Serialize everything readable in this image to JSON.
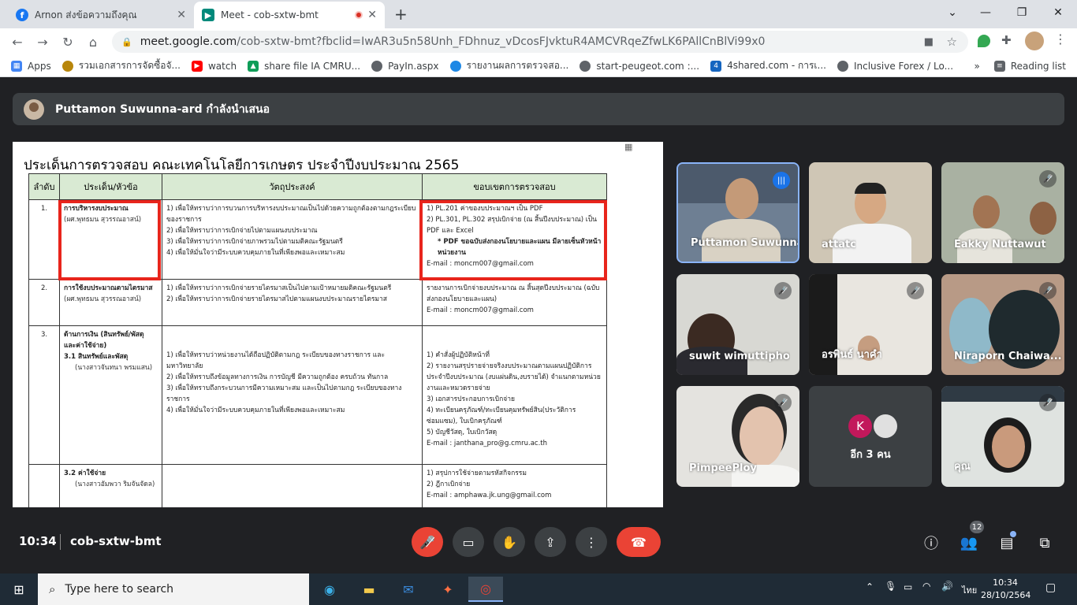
{
  "browser": {
    "tabs": [
      {
        "title": "Arnon ส่งข้อความถึงคุณ",
        "icon": "facebook-icon",
        "color": "#1877f2"
      },
      {
        "title": "Meet - cob-sxtw-bmt",
        "icon": "google-meet-icon",
        "color": "#00897b"
      }
    ],
    "url_host": "meet.google.com",
    "url_rest": "/cob-sxtw-bmt?fbclid=IwAR3u5n58Unh_FDhnuz_vDcosFJvktuR4AMCVRqeZfwLK6PAllCnBlVi99x0",
    "bookmarks": [
      {
        "label": "Apps",
        "icon": "apps-grid-icon",
        "color": "#4285f4"
      },
      {
        "label": "รวมเอกสารการจัดซื้อจั...",
        "icon": "seal-icon",
        "color": "#b8860b"
      },
      {
        "label": "watch",
        "icon": "youtube-icon",
        "color": "#ff0000"
      },
      {
        "label": "share file IA CMRU...",
        "icon": "google-drive-icon",
        "color": "#0f9d58"
      },
      {
        "label": "PayIn.aspx",
        "icon": "globe-icon",
        "color": "#5f6368"
      },
      {
        "label": "รายงานผลการตรวจสอ...",
        "icon": "web-app-icon",
        "color": "#1e88e5"
      },
      {
        "label": "start-peugeot.com :...",
        "icon": "globe-icon",
        "color": "#5f6368"
      },
      {
        "label": "4shared.com - การเ...",
        "icon": "4shared-icon",
        "color": "#1565c0"
      },
      {
        "label": "Inclusive Forex / Lo...",
        "icon": "globe-icon",
        "color": "#5f6368"
      }
    ],
    "overflow": "»",
    "reading_list": "Reading list"
  },
  "meet": {
    "presenter_banner": "Puttamon Suwunna-ard กำลังนำเสนอ",
    "time": "10:34",
    "meeting_code": "cob-sxtw-bmt",
    "people_count": "12",
    "colors": {
      "end_call": "#ea4335",
      "mic_off": "#ea4335",
      "control": "#3c4043"
    }
  },
  "document": {
    "title": "ประเด็นการตรวจสอบ คณะเทคโนโลยีการเกษตร  ประจำปีงบประมาณ 2565",
    "headers": [
      "ลำดับ",
      "ประเด็น/หัวข้อ",
      "วัตถุประสงค์",
      "ขอบเขตการตรวจสอบ"
    ],
    "rows": [
      {
        "num": "1.",
        "topic": "การบริหารงบประมาณ",
        "owner": "(ผศ.พุทธมน สุวรรณอาสน์)",
        "objectives": [
          "1)   เพื่อให้ทราบว่าการบวนการบริหารงบประมาณเป็นไปด้วยความถูกต้องตามกฎระเบียบของราชการ",
          "2)   เพื่อให้ทราบว่าการเบิกจ่ายไปตามแผนงบประมาณ",
          "3)   เพื่อให้ทราบว่าการเบิกจ่ายภาพรวมไปตามมติคณะรัฐมนตรี",
          "4)   เพื่อให้มั่นใจว่ามีระบบควบคุมภายในที่เพียงพอและเหมาะสม"
        ],
        "scope": [
          "1)   PL.201 ค่าของบประมาณฯ  เป็น PDF",
          "2)   PL.301, PL.302 สรุปเบิกจ่าย (ณ สิ้นปีงบประมาณ) เป็น PDF และ Excel",
          "* PDF ขอฉบับส่งกองนโยบายและแผน มีลายเซ็นหัวหน้าหน่วยงาน"
        ],
        "email": "E-mail : moncm007@gmail.com"
      },
      {
        "num": "2.",
        "topic": "การใช้งบประมาณตามไตรมาส",
        "owner": "(ผศ.พุทธมน สุวรรณอาสน์)",
        "objectives": [
          "1)   เพื่อให้ทราบว่าการเบิกจ่ายรายไตรมาสเป็นไปตามเป้าหมายมติคณะรัฐมนตรี",
          "2)   เพื่อให้ทราบว่าการเบิกจ่ายรายไตรมาสไปตามแผนงบประมาณรายไตรมาส"
        ],
        "scope": [
          "รายงานการเบิกจ่ายงบประมาณ ณ สิ้นสุดปีงบประมาณ (ฉบับส่งกองนโยบายและแผน)"
        ],
        "email": "E-mail : moncm007@gmail.com"
      },
      {
        "num": "3.",
        "topic": "ด้านการเงิน (สินทรัพย์/พัสดุ และค่าใช้จ่าย)",
        "sub1": "3.1  สินทรัพย์และพัสดุ",
        "owner": "(นางสาวจันทนา พรมแสน)",
        "objectives": [
          "1)   เพื่อให้ทราบว่าหน่วยงานได้ถือปฏิบัติตามกฎ ระเบียบของทางราชการ และมหาวิทยาลัย",
          "2)   เพื่อให้ทราบถึงข้อมูลทางการเงิน การบัญชี มีความถูกต้อง ครบถ้วน ทันกาล",
          "3)   เพื่อให้ทราบถึงกระบวนการมีความเหมาะสม และเป็นไปตามกฎ ระเบียบของทางราชการ",
          "4)   เพื่อให้มั่นใจว่ามีระบบควบคุมภายในที่เพียงพอและเหมาะสม"
        ],
        "scope": [
          "1)   คำสั่งผู้ปฏิบัติหน้าที่",
          "2)   รายงานสรุปรายจ่ายจริงงบประมาณตามแผนปฏิบัติการประจำปีงบประมาณ (งบแผ่นดิน,งบรายได้) จำแนกตามหน่วยงานและหมวดรายจ่าย",
          "3)   เอกสารประกอบการเบิกจ่าย",
          "4)   ทะเบียนครุภัณฑ์/ทะเบียนคุมทรัพย์สิน(ประวัติการซ่อมแซม), ใบเบิกครุภัณฑ์",
          "5)   บัญชีวัสดุ, ใบเบิกวัสดุ"
        ],
        "email": "E-mail : janthana_pro@g.cmru.ac.th"
      },
      {
        "sub2": "3.2  ค่าใช้จ่าย",
        "owner": "(นางสาวอัมพวา ริมจันจัดล)",
        "scope": [
          "1)   สรุปการใช้จ่ายตามรหัสกิจกรรม",
          "2)   ฎีกาเบิกจ่าย"
        ],
        "email": "E-mail : amphawa.jk.ung@gmail.com"
      }
    ]
  },
  "participants": [
    {
      "name": "Puttamon Suwunna",
      "status": "speaking"
    },
    {
      "name": "attatc",
      "status": "muted-hidden"
    },
    {
      "name": "Eakky Nuttawut",
      "status": "muted"
    },
    {
      "name": "suwit wimuttipho",
      "status": "muted"
    },
    {
      "name": "อรพินธ์ นาคำ",
      "status": "muted"
    },
    {
      "name": "Niraporn Chaiwa...",
      "status": "muted"
    },
    {
      "name": "PimpeePloy",
      "status": "muted"
    },
    {
      "name": "อีก 3 คน",
      "status": "more",
      "initial": "K"
    },
    {
      "name": "คุณ",
      "status": "muted"
    }
  ],
  "taskbar": {
    "search_placeholder": "Type here to search",
    "lang": "ไทย",
    "time": "10:34",
    "date": "28/10/2564"
  }
}
